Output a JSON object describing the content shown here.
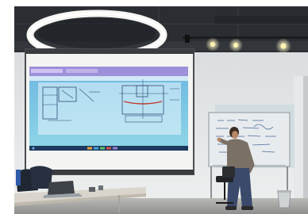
{
  "scene": {
    "kind": "photo",
    "subject": "classroom",
    "colors": {
      "ceiling": "#2a2d31",
      "wall": "#e4e7e8",
      "projection_blue": "#5aa7d8",
      "desktop_cyan": "#77cde0",
      "taskbar": "#1e3a5f",
      "ring_light": "#f5f5f2",
      "whiteboard": "#e8ebee",
      "table": "#d9d5cc",
      "shirt": "#7a7066",
      "jeans": "#3b4a6b"
    }
  }
}
